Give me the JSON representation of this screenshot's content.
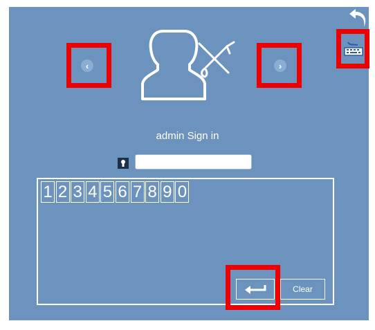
{
  "title": "admin Sign in",
  "keypad": {
    "keys": [
      "1",
      "2",
      "3",
      "4",
      "5",
      "6",
      "7",
      "8",
      "9",
      "0"
    ],
    "clear_label": "Clear"
  },
  "password": {
    "value": "",
    "placeholder": ""
  },
  "icons": {
    "prev": "chevron-left-icon",
    "next": "chevron-right-icon",
    "back": "undo-arrow-icon",
    "keyboard": "keyboard-icon",
    "user": "user-settings-icon",
    "enter": "enter-arrow-icon",
    "lock": "keyhole-icon"
  },
  "colors": {
    "background": "#6c93bd",
    "highlight": "#ee0000",
    "foreground": "#ffffff"
  }
}
